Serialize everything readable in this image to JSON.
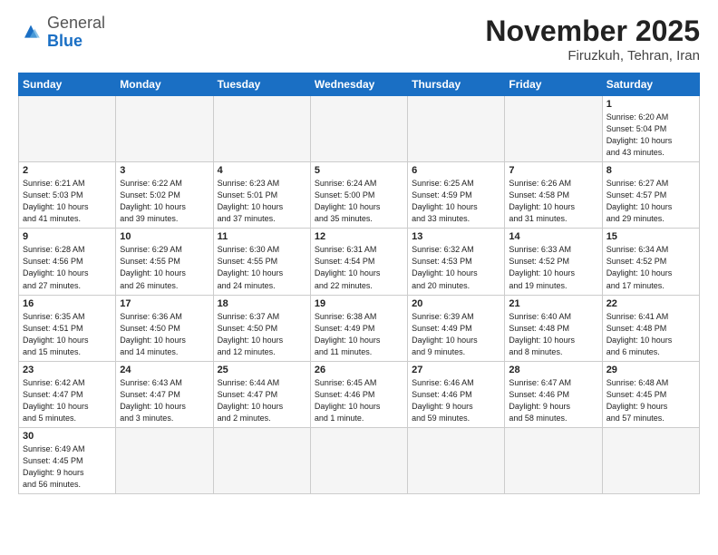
{
  "header": {
    "logo_general": "General",
    "logo_blue": "Blue",
    "month_title": "November 2025",
    "location": "Firuzkuh, Tehran, Iran"
  },
  "weekdays": [
    "Sunday",
    "Monday",
    "Tuesday",
    "Wednesday",
    "Thursday",
    "Friday",
    "Saturday"
  ],
  "weeks": [
    [
      {
        "day": "",
        "info": ""
      },
      {
        "day": "",
        "info": ""
      },
      {
        "day": "",
        "info": ""
      },
      {
        "day": "",
        "info": ""
      },
      {
        "day": "",
        "info": ""
      },
      {
        "day": "",
        "info": ""
      },
      {
        "day": "1",
        "info": "Sunrise: 6:20 AM\nSunset: 5:04 PM\nDaylight: 10 hours\nand 43 minutes."
      }
    ],
    [
      {
        "day": "2",
        "info": "Sunrise: 6:21 AM\nSunset: 5:03 PM\nDaylight: 10 hours\nand 41 minutes."
      },
      {
        "day": "3",
        "info": "Sunrise: 6:22 AM\nSunset: 5:02 PM\nDaylight: 10 hours\nand 39 minutes."
      },
      {
        "day": "4",
        "info": "Sunrise: 6:23 AM\nSunset: 5:01 PM\nDaylight: 10 hours\nand 37 minutes."
      },
      {
        "day": "5",
        "info": "Sunrise: 6:24 AM\nSunset: 5:00 PM\nDaylight: 10 hours\nand 35 minutes."
      },
      {
        "day": "6",
        "info": "Sunrise: 6:25 AM\nSunset: 4:59 PM\nDaylight: 10 hours\nand 33 minutes."
      },
      {
        "day": "7",
        "info": "Sunrise: 6:26 AM\nSunset: 4:58 PM\nDaylight: 10 hours\nand 31 minutes."
      },
      {
        "day": "8",
        "info": "Sunrise: 6:27 AM\nSunset: 4:57 PM\nDaylight: 10 hours\nand 29 minutes."
      }
    ],
    [
      {
        "day": "9",
        "info": "Sunrise: 6:28 AM\nSunset: 4:56 PM\nDaylight: 10 hours\nand 27 minutes."
      },
      {
        "day": "10",
        "info": "Sunrise: 6:29 AM\nSunset: 4:55 PM\nDaylight: 10 hours\nand 26 minutes."
      },
      {
        "day": "11",
        "info": "Sunrise: 6:30 AM\nSunset: 4:55 PM\nDaylight: 10 hours\nand 24 minutes."
      },
      {
        "day": "12",
        "info": "Sunrise: 6:31 AM\nSunset: 4:54 PM\nDaylight: 10 hours\nand 22 minutes."
      },
      {
        "day": "13",
        "info": "Sunrise: 6:32 AM\nSunset: 4:53 PM\nDaylight: 10 hours\nand 20 minutes."
      },
      {
        "day": "14",
        "info": "Sunrise: 6:33 AM\nSunset: 4:52 PM\nDaylight: 10 hours\nand 19 minutes."
      },
      {
        "day": "15",
        "info": "Sunrise: 6:34 AM\nSunset: 4:52 PM\nDaylight: 10 hours\nand 17 minutes."
      }
    ],
    [
      {
        "day": "16",
        "info": "Sunrise: 6:35 AM\nSunset: 4:51 PM\nDaylight: 10 hours\nand 15 minutes."
      },
      {
        "day": "17",
        "info": "Sunrise: 6:36 AM\nSunset: 4:50 PM\nDaylight: 10 hours\nand 14 minutes."
      },
      {
        "day": "18",
        "info": "Sunrise: 6:37 AM\nSunset: 4:50 PM\nDaylight: 10 hours\nand 12 minutes."
      },
      {
        "day": "19",
        "info": "Sunrise: 6:38 AM\nSunset: 4:49 PM\nDaylight: 10 hours\nand 11 minutes."
      },
      {
        "day": "20",
        "info": "Sunrise: 6:39 AM\nSunset: 4:49 PM\nDaylight: 10 hours\nand 9 minutes."
      },
      {
        "day": "21",
        "info": "Sunrise: 6:40 AM\nSunset: 4:48 PM\nDaylight: 10 hours\nand 8 minutes."
      },
      {
        "day": "22",
        "info": "Sunrise: 6:41 AM\nSunset: 4:48 PM\nDaylight: 10 hours\nand 6 minutes."
      }
    ],
    [
      {
        "day": "23",
        "info": "Sunrise: 6:42 AM\nSunset: 4:47 PM\nDaylight: 10 hours\nand 5 minutes."
      },
      {
        "day": "24",
        "info": "Sunrise: 6:43 AM\nSunset: 4:47 PM\nDaylight: 10 hours\nand 3 minutes."
      },
      {
        "day": "25",
        "info": "Sunrise: 6:44 AM\nSunset: 4:47 PM\nDaylight: 10 hours\nand 2 minutes."
      },
      {
        "day": "26",
        "info": "Sunrise: 6:45 AM\nSunset: 4:46 PM\nDaylight: 10 hours\nand 1 minute."
      },
      {
        "day": "27",
        "info": "Sunrise: 6:46 AM\nSunset: 4:46 PM\nDaylight: 9 hours\nand 59 minutes."
      },
      {
        "day": "28",
        "info": "Sunrise: 6:47 AM\nSunset: 4:46 PM\nDaylight: 9 hours\nand 58 minutes."
      },
      {
        "day": "29",
        "info": "Sunrise: 6:48 AM\nSunset: 4:45 PM\nDaylight: 9 hours\nand 57 minutes."
      }
    ],
    [
      {
        "day": "30",
        "info": "Sunrise: 6:49 AM\nSunset: 4:45 PM\nDaylight: 9 hours\nand 56 minutes."
      },
      {
        "day": "",
        "info": ""
      },
      {
        "day": "",
        "info": ""
      },
      {
        "day": "",
        "info": ""
      },
      {
        "day": "",
        "info": ""
      },
      {
        "day": "",
        "info": ""
      },
      {
        "day": "",
        "info": ""
      }
    ]
  ]
}
